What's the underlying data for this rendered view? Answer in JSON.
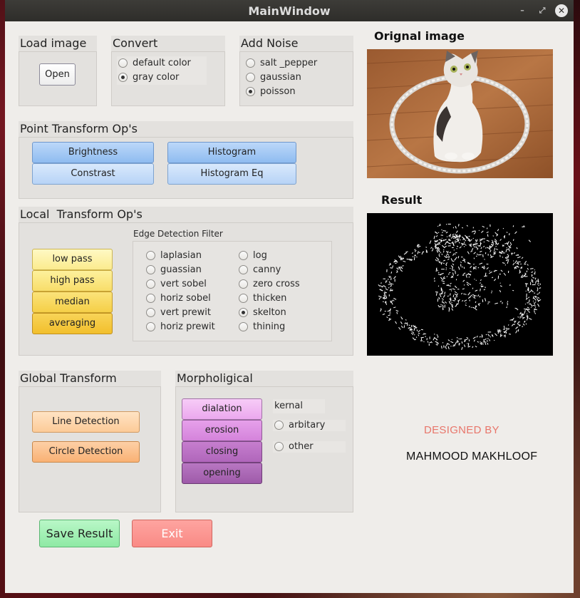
{
  "window": {
    "title": "MainWindow"
  },
  "load_image": {
    "title": "Load image",
    "open_label": "Open"
  },
  "convert": {
    "title": "Convert",
    "options": [
      {
        "label": "default color",
        "selected": false
      },
      {
        "label": "gray color",
        "selected": true
      }
    ]
  },
  "add_noise": {
    "title": "Add Noise",
    "options": [
      {
        "label": "salt _pepper",
        "selected": false
      },
      {
        "label": "gaussian",
        "selected": false
      },
      {
        "label": "poisson",
        "selected": true
      }
    ]
  },
  "point_transform": {
    "title": "Point Transform Op's",
    "buttons": {
      "brightness": "Brightness",
      "histogram": "Histogram",
      "contrast": "Constrast",
      "histogram_eq": "Histogram Eq"
    }
  },
  "local_transform": {
    "title": "Local  Transform Op's",
    "buttons": {
      "low_pass": "low pass",
      "high_pass": "high pass",
      "median": "median",
      "averaging": "averaging"
    },
    "edge_detection": {
      "title": "Edge Detection Filter",
      "left": [
        {
          "label": "laplasian",
          "selected": false
        },
        {
          "label": "guassian",
          "selected": false
        },
        {
          "label": "vert sobel",
          "selected": false
        },
        {
          "label": "horiz sobel",
          "selected": false
        },
        {
          "label": "vert prewit",
          "selected": false
        },
        {
          "label": "horiz prewit",
          "selected": false
        }
      ],
      "right": [
        {
          "label": "log",
          "selected": false
        },
        {
          "label": "canny",
          "selected": false
        },
        {
          "label": "zero cross",
          "selected": false
        },
        {
          "label": "thicken",
          "selected": false
        },
        {
          "label": "skelton",
          "selected": true
        },
        {
          "label": "thining",
          "selected": false
        }
      ]
    }
  },
  "global_transform": {
    "title": "Global Transform",
    "buttons": {
      "line_detection": "Line Detection",
      "circle_detection": "Circle Detection"
    }
  },
  "morphological": {
    "title": "Morpholigical",
    "buttons": {
      "dialation": "dialation",
      "erosion": "erosion",
      "closing": "closing",
      "opening": "opening"
    },
    "kernel_label": "kernal",
    "kernel_options": [
      {
        "label": "arbitary",
        "selected": false
      },
      {
        "label": "other",
        "selected": false
      }
    ]
  },
  "actions": {
    "save": "Save Result",
    "exit": "Exit"
  },
  "images": {
    "original_title": "Orignal image",
    "result_title": "Result"
  },
  "credits": {
    "designed_by": "DESIGNED BY",
    "author": "MAHMOOD MAKHLOOF"
  },
  "colors": {
    "credit_accent": "#e8766b",
    "result_bg": "#000000"
  },
  "icons": {
    "minimize": "minimize-icon",
    "maximize": "maximize-icon",
    "close": "close-icon"
  }
}
